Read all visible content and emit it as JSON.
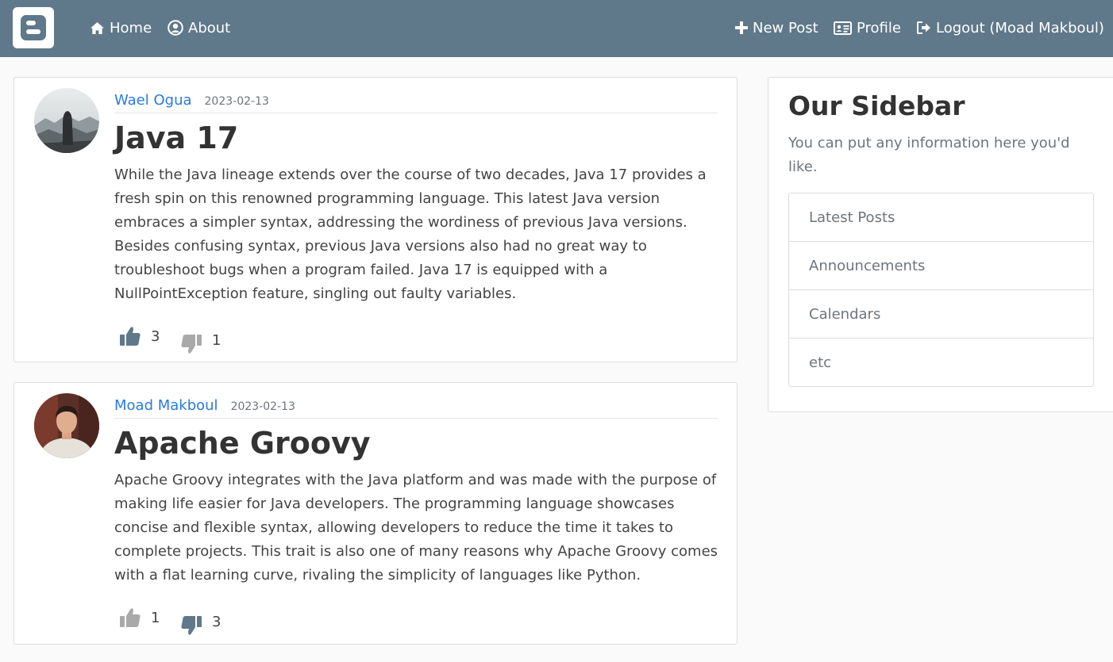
{
  "navbar": {
    "logo_icon": "blogger-logo-icon",
    "home_label": "Home",
    "about_label": "About",
    "new_post_label": "New Post",
    "profile_label": "Profile",
    "logout_label": "Logout (Moad Makboul)",
    "background_color": "#5f788a"
  },
  "posts": [
    {
      "author": "Wael Ogua",
      "date": "2023-02-13",
      "title": "Java 17",
      "content": "While the Java lineage extends over the course of two decades, Java 17 provides a fresh spin on this renowned programming language. This latest Java version embraces a simpler syntax, addressing the wordiness of previous Java versions. Besides confusing syntax, previous Java versions also had no great way to troubleshoot bugs when a program failed. Java 17 is equipped with a NullPointException feature, singling out faulty variables.",
      "likes": "3",
      "dislikes": "1",
      "liked": true,
      "disliked": false
    },
    {
      "author": "Moad Makboul",
      "date": "2023-02-13",
      "title": "Apache Groovy",
      "content": "Apache Groovy integrates with the Java platform and was made with the purpose of making life easier for Java developers. The programming language showcases concise and flexible syntax, allowing developers to reduce the time it takes to complete projects. This trait is also one of many reasons why Apache Groovy comes with a flat learning curve, rivaling the simplicity of languages like Python.",
      "likes": "1",
      "dislikes": "3",
      "liked": false,
      "disliked": true
    }
  ],
  "sidebar": {
    "title": "Our Sidebar",
    "text": "You can put any information here you'd like.",
    "items": [
      "Latest Posts",
      "Announcements",
      "Calendars",
      "etc"
    ]
  },
  "colors": {
    "accent": "#2a7ae2",
    "vote_active": "#5f788a",
    "vote_inactive": "#a9a9a9"
  }
}
